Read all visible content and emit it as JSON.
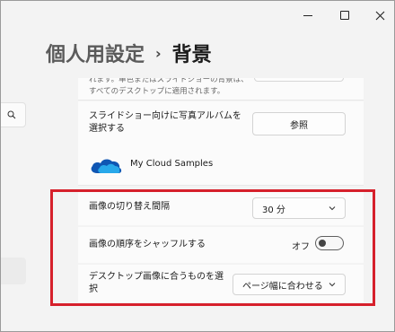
{
  "window": {
    "controls": [
      "minimize-icon",
      "maximize-icon",
      "close-icon"
    ]
  },
  "sidebar": {
    "search_icon": "search-icon"
  },
  "header": {
    "parent": "個人用設定",
    "separator": "›",
    "current": "背景"
  },
  "top_card": {
    "description_line1": "れます。単色またはスライドショーの背景は、",
    "description_line2": "すべてのデスクトップに適用されます。"
  },
  "album": {
    "label": "スライドショー向けに写真アルバムを選択する",
    "browse_label": "参照",
    "source_icon": "onedrive-cloud-icon",
    "source_name": "My Cloud Samples"
  },
  "settings": {
    "interval": {
      "label": "画像の切り替え間隔",
      "value": "30 分"
    },
    "shuffle": {
      "label": "画像の順序をシャッフルする",
      "state_label": "オフ",
      "on": false
    },
    "fit": {
      "label": "デスクトップ画像に合うものを選択",
      "value": "ページ幅に合わせる"
    }
  },
  "colors": {
    "highlight": "#d6202b",
    "cloud_dark": "#0f56b3",
    "cloud_light": "#28a8ea"
  }
}
